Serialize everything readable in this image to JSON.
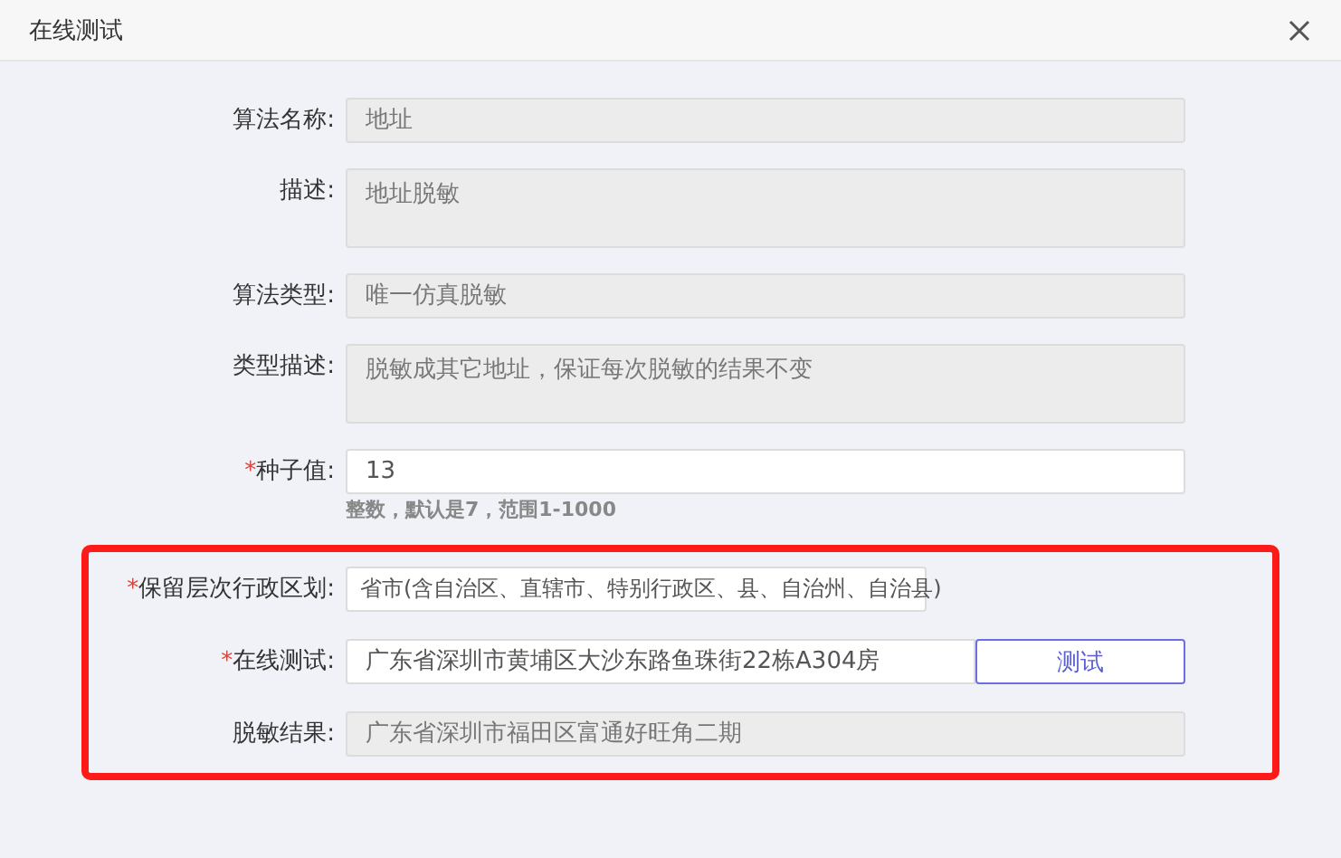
{
  "window": {
    "title": "在线测试"
  },
  "fields": [
    {
      "kind": "readonly",
      "label": "算法名称:",
      "value": "地址"
    },
    {
      "kind": "textarea",
      "label": "描述:",
      "value": "地址脱敏"
    },
    {
      "kind": "readonly",
      "label": "算法类型:",
      "value": "唯一仿真脱敏"
    },
    {
      "kind": "textarea",
      "label": "类型描述:",
      "value": "脱敏成其它地址，保证每次脱敏的结果不变"
    },
    {
      "kind": "input",
      "label": "种子值:",
      "required_mark": "*",
      "value": "13",
      "hint": "整数，默认是7，范围1-1000"
    }
  ],
  "highlighted_fields": [
    {
      "kind": "select",
      "label": "保留层次行政区划:",
      "required_mark": "*",
      "value": "省市(含自治区、直辖市、特别行政区、县、自治州、自治县)"
    },
    {
      "kind": "input-button",
      "label": "在线测试:",
      "required_mark": "*",
      "value": "广东省深圳市黄埔区大沙东路鱼珠街22栋A304房",
      "button": "测试"
    },
    {
      "kind": "readonly",
      "label": "脱敏结果:",
      "value": "广东省深圳市福田区富通好旺角二期"
    }
  ]
}
